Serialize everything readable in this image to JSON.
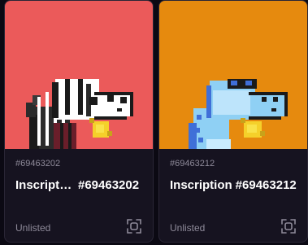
{
  "cards": [
    {
      "number": "#69463202",
      "title_prefix": "Inscription",
      "title_number": "#69463202",
      "status": "Unlisted",
      "background": "#eb5a5a",
      "icon": "scan-icon"
    },
    {
      "number": "#69463212",
      "title_prefix": "Inscription",
      "title_number": "#69463212",
      "status": "Unlisted",
      "background": "#e68a0e",
      "icon": "scan-icon"
    }
  ]
}
